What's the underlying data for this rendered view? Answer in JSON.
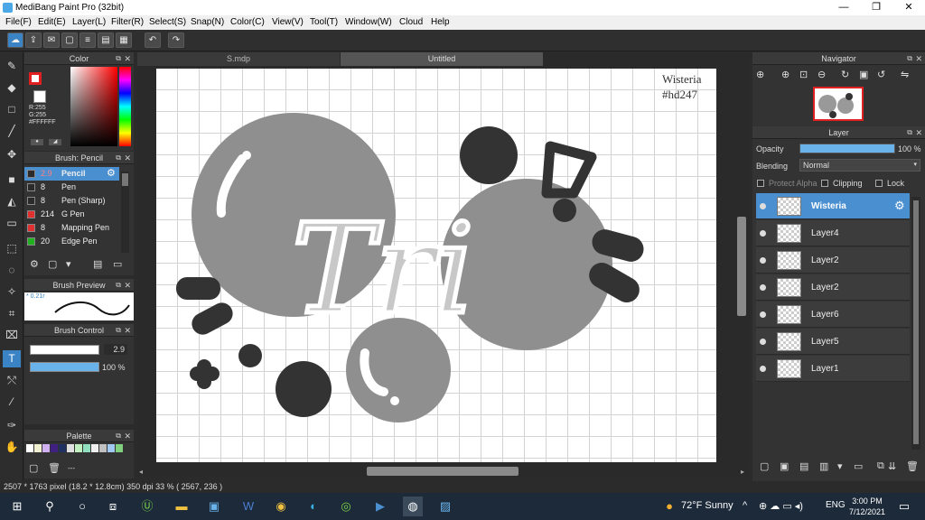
{
  "window": {
    "title": "MediBang Paint Pro (32bit)"
  },
  "menu": [
    "File(F)",
    "Edit(E)",
    "Layer(L)",
    "Filter(R)",
    "Select(S)",
    "Snap(N)",
    "Color(C)",
    "View(V)",
    "Tool(T)",
    "Window(W)",
    "Cloud",
    "Help"
  ],
  "color_panel": {
    "title": "Color",
    "r": "R:255",
    "g": "G:255",
    "b": "B:255",
    "hex": "#FFFFFF"
  },
  "brush_panel": {
    "title": "Brush: Pencil",
    "items": [
      {
        "size": "2.9",
        "name": "Pencil",
        "color": "#2b2b2b"
      },
      {
        "size": "8",
        "name": "Pen",
        "color": "#2b2b2b"
      },
      {
        "size": "8",
        "name": "Pen (Sharp)",
        "color": "#2b2b2b"
      },
      {
        "size": "214",
        "name": "G Pen",
        "color": "#e03030"
      },
      {
        "size": "8",
        "name": "Mapping Pen",
        "color": "#e03030"
      },
      {
        "size": "20",
        "name": "Edge Pen",
        "color": "#20b020"
      }
    ]
  },
  "brush_preview": {
    "title": "Brush Preview",
    "value": "* 0.21r"
  },
  "brush_control": {
    "title": "Brush Control",
    "size": "2.9",
    "opacity": "100 %",
    "size_level": 0.95,
    "opacity_level": 1.0
  },
  "palette": {
    "title": "Palette",
    "label": "---",
    "colors": [
      "#ffffff",
      "#f0f0d0",
      "#d0b0f0",
      "#402080",
      "#203060",
      "#e0e0e0",
      "#c0f0c0",
      "#90e0c0",
      "#f0f0f0",
      "#c0c0c0",
      "#a0c8f0",
      "#80d080"
    ]
  },
  "tabs": {
    "doc1": "S.mdp",
    "doc2": "Untitled"
  },
  "canvas": {
    "note_line1": "Wisteria",
    "note_line2": "#hd247",
    "art_text": "Tri"
  },
  "navigator": {
    "title": "Navigator"
  },
  "layer_panel": {
    "title": "Layer",
    "opacity_label": "Opacity",
    "opacity_value": "100 %",
    "blending_label": "Blending",
    "blending_value": "Normal",
    "protect_alpha": "Protect Alpha",
    "clipping": "Clipping",
    "lock": "Lock",
    "layers": [
      "Wisteria",
      "Layer4",
      "Layer2",
      "Layer2",
      "Layer6",
      "Layer5",
      "Layer1"
    ]
  },
  "status": {
    "text": "2507 * 1763 pixel  (18.2 * 12.8cm)  350 dpi  33 %  ( 2567, 236 )"
  },
  "taskbar": {
    "weather": "72°F  Sunny",
    "lang": "ENG",
    "time": "3:00 PM",
    "date": "7/12/2021"
  }
}
